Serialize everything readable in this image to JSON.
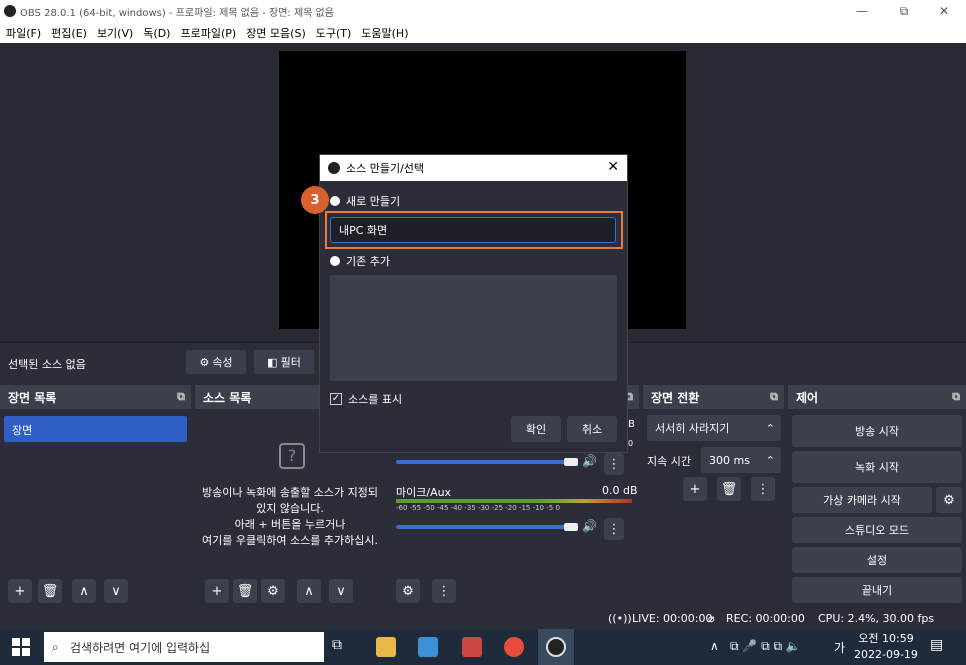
{
  "window": {
    "title": "OBS 28.0.1 (64-bit, windows) - 프로파일: 제목 없음 - 장면: 제목 없음",
    "minimize": "—",
    "maximize": "⧉",
    "close": "✕"
  },
  "menu": [
    "파일(F)",
    "편집(E)",
    "보기(V)",
    "독(D)",
    "프로파일(P)",
    "장면 모음(S)",
    "도구(T)",
    "도움말(H)"
  ],
  "source_bar": {
    "no_source": "선택된 소스 없음",
    "properties": "속성",
    "filters": "필터"
  },
  "scenes": {
    "title": "장면 목록",
    "items": [
      "장면"
    ]
  },
  "sources": {
    "title": "소스 목록",
    "empty_lines": [
      "방송이나 녹화에 송출할 소스가 지정되",
      "있지 않습니다.",
      "아래 + 버튼을 누르거나",
      "여기를 우클릭하여 소스를 추가하십시."
    ]
  },
  "mixer": {
    "channels": [
      {
        "name": "",
        "db": "0.0 dB"
      },
      {
        "name": "마이크/Aux",
        "db": "0.0 dB"
      }
    ],
    "scale": "-60 -55 -50 -45 -40 -35 -30 -25 -20 -15 -10 -5 0",
    "scale_partial": "0",
    "db_partial": "B"
  },
  "transitions": {
    "title": "장면 전환",
    "selected": "서서히 사라지기",
    "duration_label": "지속 시간",
    "duration_value": "300 ms"
  },
  "controls": {
    "title": "제어",
    "buttons": [
      "방송 시작",
      "녹화 시작",
      "가상 카메라 시작",
      "스튜디오 모드",
      "설정",
      "끝내기"
    ]
  },
  "status": {
    "live": "LIVE: 00:00:00",
    "rec": "REC: 00:00:00",
    "cpu": "CPU: 2.4%, 30.00 fps"
  },
  "dialog": {
    "title": "소스 만들기/선택",
    "close": "✕",
    "step": "3",
    "create_new": "새로 만들기",
    "name_value": "내PC 화면",
    "add_existing": "기존 추가",
    "show_source": "소스를 표시",
    "ok": "확인",
    "cancel": "취소"
  },
  "taskbar": {
    "search_placeholder": "검색하려면 여기에 입력하십",
    "tray_lang": "가",
    "time": "오전 10:59",
    "date": "2022-09-19"
  }
}
